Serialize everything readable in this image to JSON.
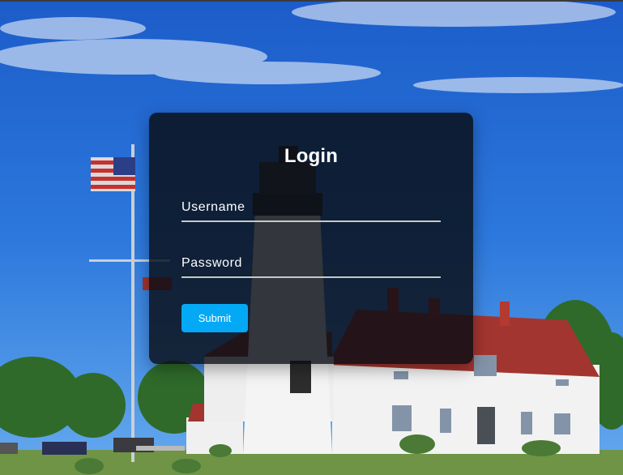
{
  "login": {
    "title": "Login",
    "username_label": "Username",
    "password_label": "Password",
    "submit_label": "Submit"
  },
  "colors": {
    "submit_button": "#03a9f4",
    "card_background": "#080c14",
    "sky": "#2f7de0"
  }
}
